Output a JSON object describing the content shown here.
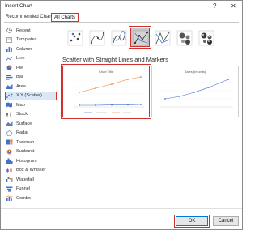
{
  "window": {
    "title": "Insert Chart",
    "help_glyph": "?",
    "close_glyph": "✕"
  },
  "tabs": [
    {
      "label": "Recommended Charts"
    },
    {
      "label": "All Charts"
    }
  ],
  "sidebar": {
    "items": [
      {
        "label": "Recent",
        "icon": "recent-icon"
      },
      {
        "label": "Templates",
        "icon": "templates-icon"
      },
      {
        "label": "Column",
        "icon": "column-chart-icon"
      },
      {
        "label": "Line",
        "icon": "line-chart-icon"
      },
      {
        "label": "Pie",
        "icon": "pie-chart-icon"
      },
      {
        "label": "Bar",
        "icon": "bar-chart-icon"
      },
      {
        "label": "Area",
        "icon": "area-chart-icon"
      },
      {
        "label": "X Y (Scatter)",
        "icon": "scatter-chart-icon",
        "selected": true
      },
      {
        "label": "Map",
        "icon": "map-chart-icon"
      },
      {
        "label": "Stock",
        "icon": "stock-chart-icon"
      },
      {
        "label": "Surface",
        "icon": "surface-chart-icon"
      },
      {
        "label": "Radar",
        "icon": "radar-chart-icon"
      },
      {
        "label": "Treemap",
        "icon": "treemap-chart-icon"
      },
      {
        "label": "Sunburst",
        "icon": "sunburst-chart-icon"
      },
      {
        "label": "Histogram",
        "icon": "histogram-chart-icon"
      },
      {
        "label": "Box & Whisker",
        "icon": "box-whisker-chart-icon"
      },
      {
        "label": "Waterfall",
        "icon": "waterfall-chart-icon"
      },
      {
        "label": "Funnel",
        "icon": "funnel-chart-icon"
      },
      {
        "label": "Combo",
        "icon": "combo-chart-icon"
      }
    ]
  },
  "subtypes": [
    {
      "name": "scatter-icon"
    },
    {
      "name": "scatter-smooth-markers-icon"
    },
    {
      "name": "scatter-smooth-lines-icon"
    },
    {
      "name": "scatter-straight-lines-markers-icon",
      "selected": true
    },
    {
      "name": "scatter-straight-lines-icon"
    },
    {
      "name": "bubble-icon"
    },
    {
      "name": "3d-bubble-icon"
    }
  ],
  "selected_subtype_title": "Scatter with Straight Lines and Markers",
  "previews": [
    {
      "title": "Chart Title",
      "selected": true
    },
    {
      "title": "Sales (in units)",
      "selected": false
    }
  ],
  "buttons": {
    "ok": "OK",
    "cancel": "Cancel"
  },
  "colors": {
    "accent_red": "#d0312d",
    "series_blue": "#4472c4",
    "series_orange": "#ed7d31"
  }
}
